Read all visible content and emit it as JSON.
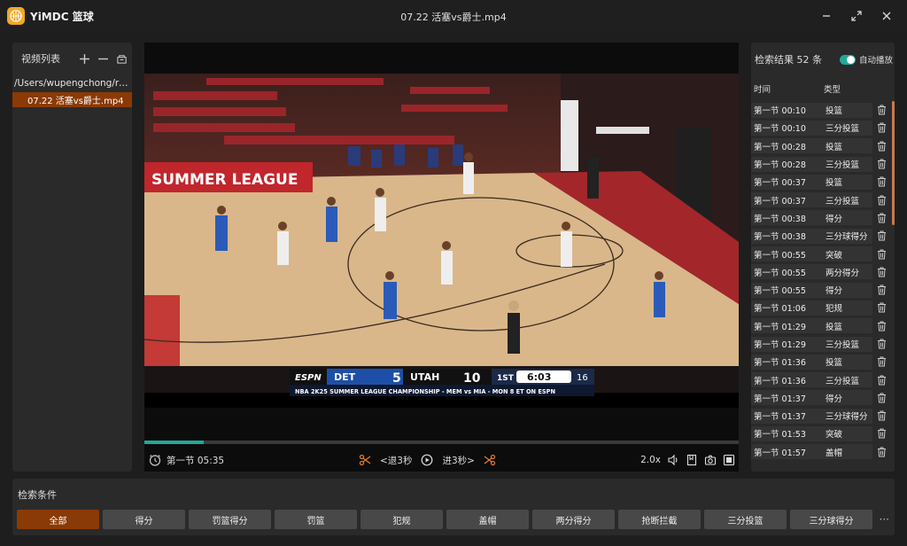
{
  "app": {
    "name": "YiMDC 篮球",
    "window_title": "07.22 活塞vs爵士.mp4"
  },
  "left_panel": {
    "title": "视频列表",
    "path": "/Users/wupengchong/rocdi…",
    "files": [
      "07.22 活塞vs爵士.mp4"
    ]
  },
  "video": {
    "scoreboard": {
      "network": "ESPN",
      "home_team": "DET",
      "home_score": "5",
      "away_team": "UTAH",
      "away_score": "10",
      "period": "1ST",
      "clock": "6:03",
      "shot_clock": "16",
      "ticker": "NBA 2K25 SUMMER LEAGUE CHAMPIONSHIP - MEM vs MIA - MON 8 ET ON ESPN"
    },
    "banner_left": "SUMMER LEAGUE",
    "progress": 0.1
  },
  "controls": {
    "timestamp": "第一节 05:35",
    "back_label": "<退3秒",
    "forward_label": "进3秒>",
    "speed": "2.0x"
  },
  "right_panel": {
    "count_label": "检索结果 52 条",
    "autoplay_label": "自动播放",
    "col_time": "时间",
    "col_type": "类型",
    "rows": [
      {
        "time": "第一节 00:10",
        "type": "投篮"
      },
      {
        "time": "第一节 00:10",
        "type": "三分投篮"
      },
      {
        "time": "第一节 00:28",
        "type": "投篮"
      },
      {
        "time": "第一节 00:28",
        "type": "三分投篮"
      },
      {
        "time": "第一节 00:37",
        "type": "投篮"
      },
      {
        "time": "第一节 00:37",
        "type": "三分投篮"
      },
      {
        "time": "第一节 00:38",
        "type": "得分"
      },
      {
        "time": "第一节 00:38",
        "type": "三分球得分"
      },
      {
        "time": "第一节 00:55",
        "type": "突破"
      },
      {
        "time": "第一节 00:55",
        "type": "两分得分"
      },
      {
        "time": "第一节 00:55",
        "type": "得分"
      },
      {
        "time": "第一节 01:06",
        "type": "犯规"
      },
      {
        "time": "第一节 01:29",
        "type": "投篮"
      },
      {
        "time": "第一节 01:29",
        "type": "三分投篮"
      },
      {
        "time": "第一节 01:36",
        "type": "投篮"
      },
      {
        "time": "第一节 01:36",
        "type": "三分投篮"
      },
      {
        "time": "第一节 01:37",
        "type": "得分"
      },
      {
        "time": "第一节 01:37",
        "type": "三分球得分"
      },
      {
        "time": "第一节 01:53",
        "type": "突破"
      },
      {
        "time": "第一节 01:57",
        "type": "盖帽"
      }
    ]
  },
  "filters": {
    "title": "检索条件",
    "chips": [
      "全部",
      "得分",
      "罚篮得分",
      "罚篮",
      "犯规",
      "盖帽",
      "两分得分",
      "抢断拦截",
      "三分投篮",
      "三分球得分"
    ],
    "active": 0,
    "more": "···"
  }
}
